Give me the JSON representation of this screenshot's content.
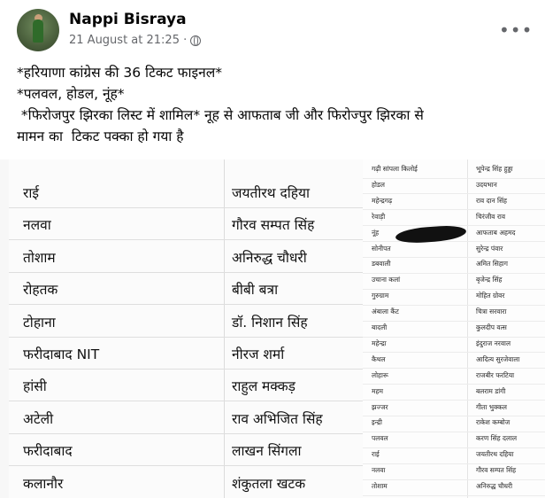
{
  "post": {
    "author": "Nappi Bisraya",
    "timestamp": "21 August at 21:25 ·",
    "more_icon": "more-options-icon",
    "privacy_icon": "globe-icon",
    "lines": [
      "*हरियाणा कांग्रेस की 36 टिकट फाइनल*",
      "*पलवल, होडल, नूंह*",
      " *फिरोजपुर झिरका लिस्ट में शामिल* नूह से आफताब जी और फिरोज्पुर झिरका से",
      "मामन का  टिकट पक्का हो गया है"
    ]
  },
  "image": {
    "left_rows": [
      {
        "constituency": "राई",
        "candidate": "जयतीरथ दहिया"
      },
      {
        "constituency": "नलवा",
        "candidate": "गौरव सम्पत सिंह"
      },
      {
        "constituency": "तोशाम",
        "candidate": "अनिरुद्ध चौधरी"
      },
      {
        "constituency": "रोहतक",
        "candidate": "बीबी बत्रा"
      },
      {
        "constituency": "टोहाना",
        "candidate": "डॉ. निशान सिंह"
      },
      {
        "constituency": "फरीदाबाद NIT",
        "candidate": "नीरज शर्मा"
      },
      {
        "constituency": "हांसी",
        "candidate": "राहुल मक्कड़"
      },
      {
        "constituency": "अटेली",
        "candidate": "राव अभिजित सिंह"
      },
      {
        "constituency": "फरीदाबाद",
        "candidate": "लाखन सिंगला"
      },
      {
        "constituency": "कलानौर",
        "candidate": "शंकुतला खटक"
      }
    ],
    "right_rows": [
      {
        "constituency": "गढ़ी सांपला किलोई",
        "candidate": "भूपेन्द्र सिंह हुड्डा"
      },
      {
        "constituency": "होडल",
        "candidate": "उदयभान"
      },
      {
        "constituency": "महेन्द्रगढ़",
        "candidate": "राव दान सिंह"
      },
      {
        "constituency": "रेवाड़ी",
        "candidate": "चिरंजीव राव"
      },
      {
        "constituency": "नूंह",
        "candidate": "आफताब अहमद"
      },
      {
        "constituency": "सोनीपत",
        "candidate": "सुरेन्द्र पंवार"
      },
      {
        "constituency": "डबवाली",
        "candidate": "अमित सिहाग"
      },
      {
        "constituency": "उचाना कलां",
        "candidate": "बृजेन्द्र सिंह"
      },
      {
        "constituency": "गुरुग्राम",
        "candidate": "मोहित ग्रोवर"
      },
      {
        "constituency": "अंबाला कैंट",
        "candidate": "चित्रा सरवारा"
      },
      {
        "constituency": "बादली",
        "candidate": "कुलदीप वत्स"
      },
      {
        "constituency": "महेन्द्रा",
        "candidate": "इंदुराज नरवाल"
      },
      {
        "constituency": "कैथल",
        "candidate": "आदित्य सुरजेवाला"
      },
      {
        "constituency": "लोहारू",
        "candidate": "राजबीर फरटिया"
      },
      {
        "constituency": "महम",
        "candidate": "बलराम डांगी"
      },
      {
        "constituency": "झज्जर",
        "candidate": "गीता भुक्कल"
      },
      {
        "constituency": "इन्द्री",
        "candidate": "राकेश कम्बोज"
      },
      {
        "constituency": "पलवल",
        "candidate": "करण सिंह दलाल"
      },
      {
        "constituency": "राई",
        "candidate": "जयतीरथ दहिया"
      },
      {
        "constituency": "नलवा",
        "candidate": "गौरव सम्पत सिंह"
      },
      {
        "constituency": "तोशाम",
        "candidate": "अनिरुद्ध चौधरी"
      }
    ]
  }
}
